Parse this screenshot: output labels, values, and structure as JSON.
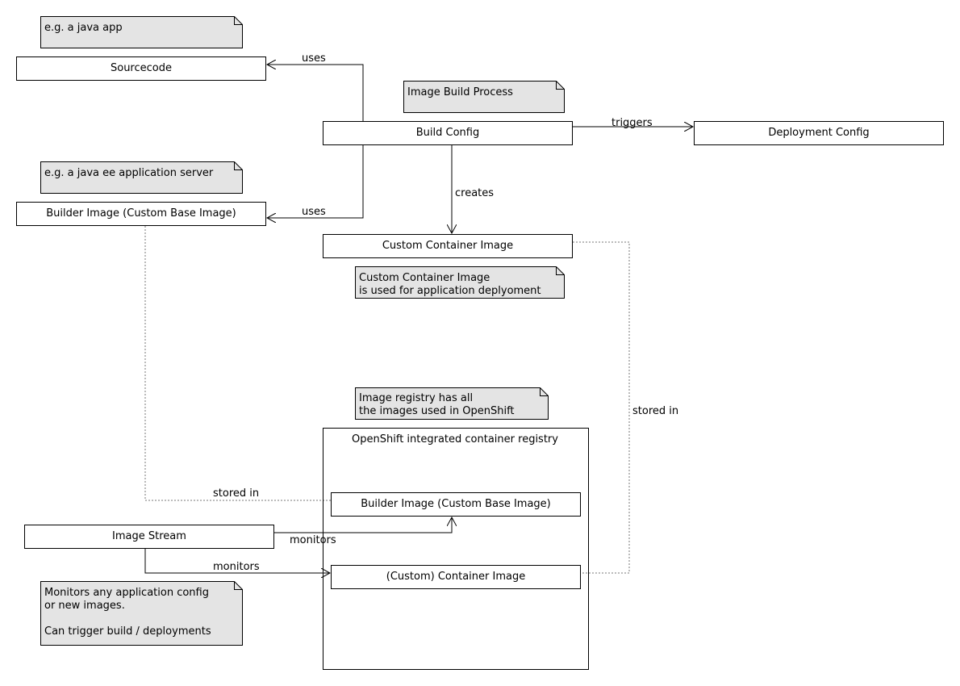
{
  "colors": {
    "note_fill": "#e4e4e4",
    "box_fill": "#ffffff",
    "line": "#000000",
    "dotted_line": "#777777"
  },
  "notes": {
    "java_app": [
      "e.g. a java app"
    ],
    "build_process": [
      "Image Build Process"
    ],
    "app_server": [
      "e.g. a java ee application server"
    ],
    "custom_image": [
      "Custom Container Image",
      "is used for application deplyoment"
    ],
    "registry": [
      "Image registry has all",
      "the images used in OpenShift"
    ],
    "image_stream": [
      "Monitors any application config",
      "or new images.",
      "",
      "Can trigger build / deployments"
    ]
  },
  "nodes": {
    "sourcecode": "Sourcecode",
    "build_config": "Build Config",
    "deployment_config": "Deployment Config",
    "builder_image": "Builder Image (Custom Base Image)",
    "custom_container_image": "Custom Container Image",
    "registry": "OpenShift integrated container registry",
    "registry_builder_image": "Builder Image (Custom Base Image)",
    "registry_container_image": "(Custom) Container Image",
    "image_stream": "Image Stream"
  },
  "edges": {
    "uses_source": "uses",
    "uses_builder": "uses",
    "triggers": "triggers",
    "creates": "creates",
    "stored_in_custom": "stored in",
    "stored_in_builder": "stored in",
    "monitors_builder": "monitors",
    "monitors_container": "monitors"
  }
}
